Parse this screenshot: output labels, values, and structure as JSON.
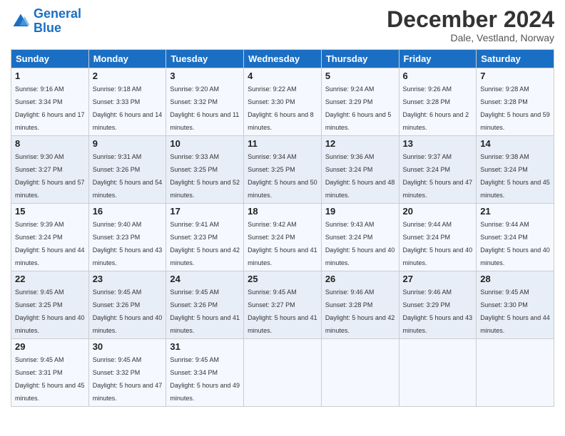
{
  "header": {
    "logo_line1": "General",
    "logo_line2": "Blue",
    "month": "December 2024",
    "location": "Dale, Vestland, Norway"
  },
  "weekdays": [
    "Sunday",
    "Monday",
    "Tuesday",
    "Wednesday",
    "Thursday",
    "Friday",
    "Saturday"
  ],
  "weeks": [
    [
      {
        "day": "1",
        "sunrise": "9:16 AM",
        "sunset": "3:34 PM",
        "daylight": "6 hours and 17 minutes."
      },
      {
        "day": "2",
        "sunrise": "9:18 AM",
        "sunset": "3:33 PM",
        "daylight": "6 hours and 14 minutes."
      },
      {
        "day": "3",
        "sunrise": "9:20 AM",
        "sunset": "3:32 PM",
        "daylight": "6 hours and 11 minutes."
      },
      {
        "day": "4",
        "sunrise": "9:22 AM",
        "sunset": "3:30 PM",
        "daylight": "6 hours and 8 minutes."
      },
      {
        "day": "5",
        "sunrise": "9:24 AM",
        "sunset": "3:29 PM",
        "daylight": "6 hours and 5 minutes."
      },
      {
        "day": "6",
        "sunrise": "9:26 AM",
        "sunset": "3:28 PM",
        "daylight": "6 hours and 2 minutes."
      },
      {
        "day": "7",
        "sunrise": "9:28 AM",
        "sunset": "3:28 PM",
        "daylight": "5 hours and 59 minutes."
      }
    ],
    [
      {
        "day": "8",
        "sunrise": "9:30 AM",
        "sunset": "3:27 PM",
        "daylight": "5 hours and 57 minutes."
      },
      {
        "day": "9",
        "sunrise": "9:31 AM",
        "sunset": "3:26 PM",
        "daylight": "5 hours and 54 minutes."
      },
      {
        "day": "10",
        "sunrise": "9:33 AM",
        "sunset": "3:25 PM",
        "daylight": "5 hours and 52 minutes."
      },
      {
        "day": "11",
        "sunrise": "9:34 AM",
        "sunset": "3:25 PM",
        "daylight": "5 hours and 50 minutes."
      },
      {
        "day": "12",
        "sunrise": "9:36 AM",
        "sunset": "3:24 PM",
        "daylight": "5 hours and 48 minutes."
      },
      {
        "day": "13",
        "sunrise": "9:37 AM",
        "sunset": "3:24 PM",
        "daylight": "5 hours and 47 minutes."
      },
      {
        "day": "14",
        "sunrise": "9:38 AM",
        "sunset": "3:24 PM",
        "daylight": "5 hours and 45 minutes."
      }
    ],
    [
      {
        "day": "15",
        "sunrise": "9:39 AM",
        "sunset": "3:24 PM",
        "daylight": "5 hours and 44 minutes."
      },
      {
        "day": "16",
        "sunrise": "9:40 AM",
        "sunset": "3:23 PM",
        "daylight": "5 hours and 43 minutes."
      },
      {
        "day": "17",
        "sunrise": "9:41 AM",
        "sunset": "3:23 PM",
        "daylight": "5 hours and 42 minutes."
      },
      {
        "day": "18",
        "sunrise": "9:42 AM",
        "sunset": "3:24 PM",
        "daylight": "5 hours and 41 minutes."
      },
      {
        "day": "19",
        "sunrise": "9:43 AM",
        "sunset": "3:24 PM",
        "daylight": "5 hours and 40 minutes."
      },
      {
        "day": "20",
        "sunrise": "9:44 AM",
        "sunset": "3:24 PM",
        "daylight": "5 hours and 40 minutes."
      },
      {
        "day": "21",
        "sunrise": "9:44 AM",
        "sunset": "3:24 PM",
        "daylight": "5 hours and 40 minutes."
      }
    ],
    [
      {
        "day": "22",
        "sunrise": "9:45 AM",
        "sunset": "3:25 PM",
        "daylight": "5 hours and 40 minutes."
      },
      {
        "day": "23",
        "sunrise": "9:45 AM",
        "sunset": "3:26 PM",
        "daylight": "5 hours and 40 minutes."
      },
      {
        "day": "24",
        "sunrise": "9:45 AM",
        "sunset": "3:26 PM",
        "daylight": "5 hours and 41 minutes."
      },
      {
        "day": "25",
        "sunrise": "9:45 AM",
        "sunset": "3:27 PM",
        "daylight": "5 hours and 41 minutes."
      },
      {
        "day": "26",
        "sunrise": "9:46 AM",
        "sunset": "3:28 PM",
        "daylight": "5 hours and 42 minutes."
      },
      {
        "day": "27",
        "sunrise": "9:46 AM",
        "sunset": "3:29 PM",
        "daylight": "5 hours and 43 minutes."
      },
      {
        "day": "28",
        "sunrise": "9:45 AM",
        "sunset": "3:30 PM",
        "daylight": "5 hours and 44 minutes."
      }
    ],
    [
      {
        "day": "29",
        "sunrise": "9:45 AM",
        "sunset": "3:31 PM",
        "daylight": "5 hours and 45 minutes."
      },
      {
        "day": "30",
        "sunrise": "9:45 AM",
        "sunset": "3:32 PM",
        "daylight": "5 hours and 47 minutes."
      },
      {
        "day": "31",
        "sunrise": "9:45 AM",
        "sunset": "3:34 PM",
        "daylight": "5 hours and 49 minutes."
      },
      null,
      null,
      null,
      null
    ]
  ]
}
